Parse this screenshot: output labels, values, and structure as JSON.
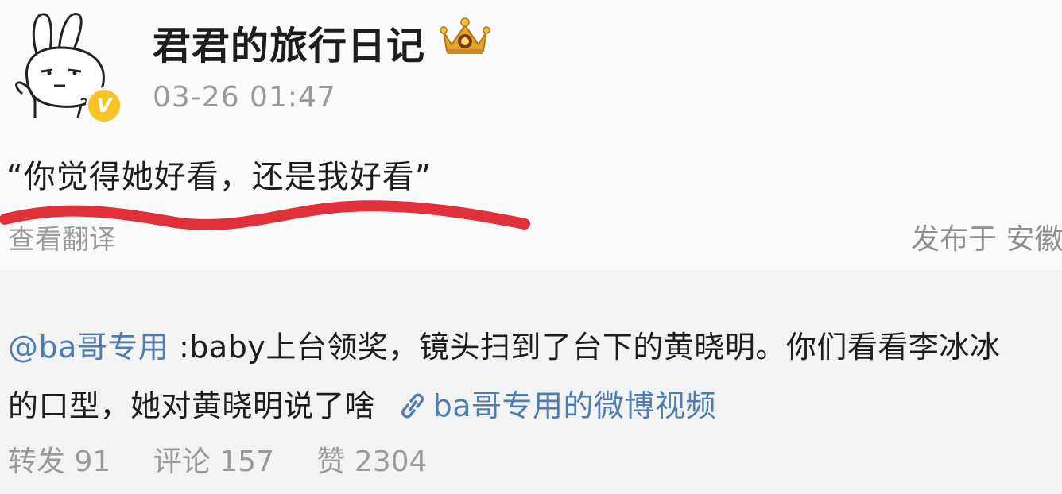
{
  "post": {
    "username": "君君的旅行日记",
    "timestamp": "03-26 01:47",
    "text": "“你觉得她好看，还是我好看”",
    "translate_label": "查看翻译",
    "publish_location": "发布于 安徽"
  },
  "repost": {
    "mention": "@ba哥专用",
    "line1_text": " :baby上台领奖，镜头扫到了台下的黄晓明。你们看看李冰冰",
    "line2_text": "的口型，她对黄晓明说了啥",
    "video_link": "ba哥专用的微博视频",
    "stats": {
      "reposts": "转发 91",
      "comments": "评论 157",
      "likes": "赞 2304"
    }
  },
  "colors": {
    "link": "#507daf",
    "muted": "#9a9a9a",
    "underline": "#e0303a",
    "verified_badge": "#f7c325"
  },
  "icons": {
    "avatar": "rabbit-avatar",
    "verified": "verified-badge-icon",
    "crown": "crown-icon",
    "link": "link-icon"
  }
}
